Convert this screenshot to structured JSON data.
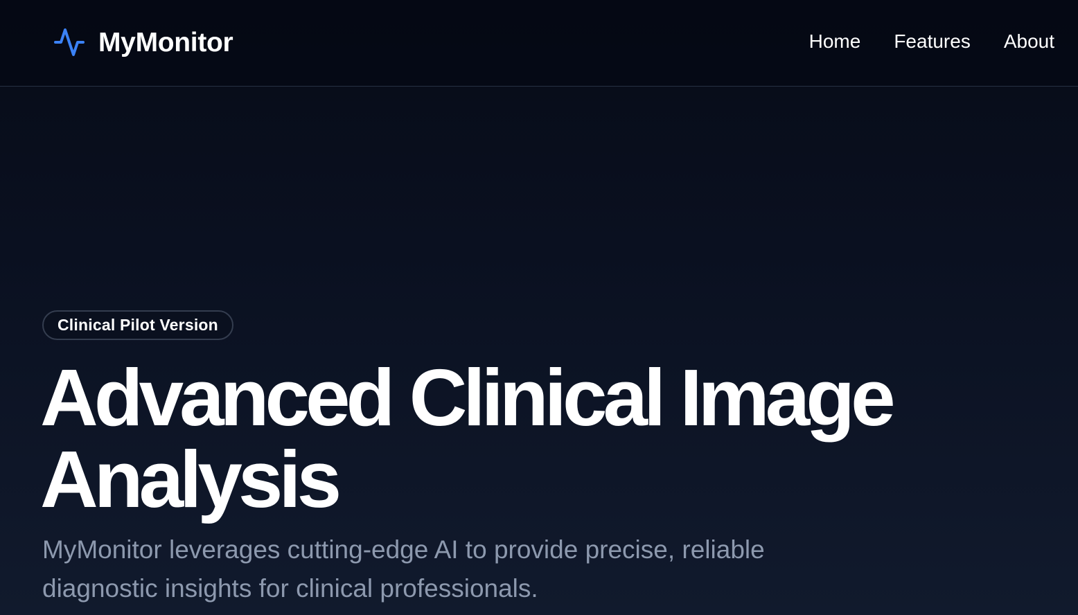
{
  "brand": {
    "name": "MyMonitor",
    "icon": "activity-pulse-icon",
    "icon_color": "#3b82f6"
  },
  "nav": {
    "items": [
      {
        "label": "Home"
      },
      {
        "label": "Features"
      },
      {
        "label": "About"
      }
    ]
  },
  "hero": {
    "badge": "Clinical Pilot Version",
    "title": "Advanced Clinical Image Analysis",
    "subtitle": "MyMonitor leverages cutting-edge AI to provide precise, reliable diagnostic insights for clinical professionals."
  },
  "colors": {
    "background_top": "#070b17",
    "background_bottom": "#111a2d",
    "text_primary": "#ffffff",
    "text_muted": "#8d99ae",
    "accent": "#3b82f6"
  }
}
